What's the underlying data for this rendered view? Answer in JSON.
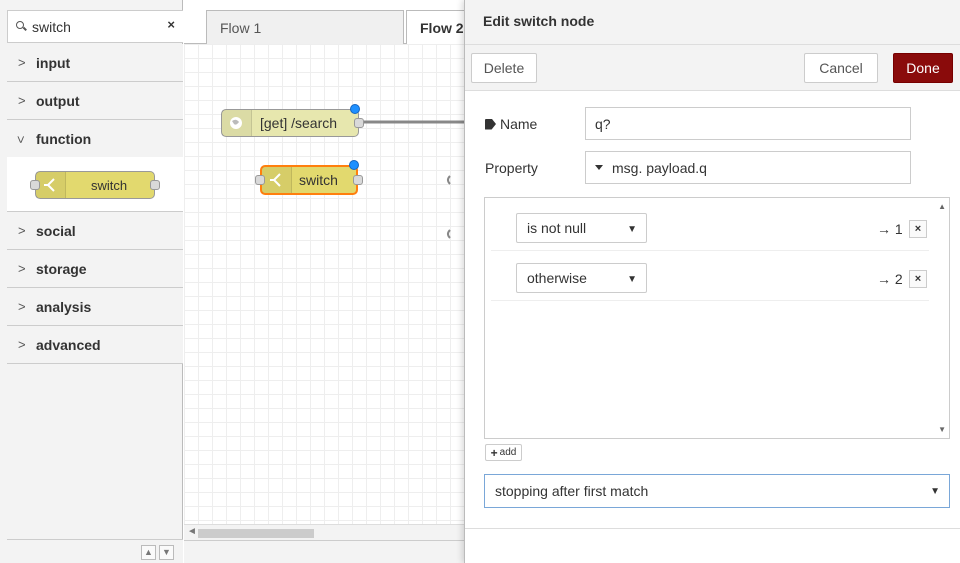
{
  "palette": {
    "search_value": "switch",
    "search_icon": "search-icon",
    "clear_icon": "×",
    "categories": [
      {
        "label": "input",
        "open": false
      },
      {
        "label": "output",
        "open": false
      },
      {
        "label": "function",
        "open": true
      },
      {
        "label": "social",
        "open": false
      },
      {
        "label": "storage",
        "open": false
      },
      {
        "label": "analysis",
        "open": false
      },
      {
        "label": "advanced",
        "open": false
      }
    ],
    "function_node_label": "switch",
    "footer_up": "▲",
    "footer_down": "▼"
  },
  "workspace": {
    "tabs": [
      {
        "label": "Flow 1",
        "active": false
      },
      {
        "label": "Flow 2",
        "active": true
      }
    ],
    "nodes": {
      "http_in_label": "[get] /search",
      "switch_label": "switch"
    },
    "scroll_arrow": "◄"
  },
  "editor": {
    "title": "Edit switch node",
    "delete_label": "Delete",
    "cancel_label": "Cancel",
    "done_label": "Done",
    "name_label": "Name",
    "name_value": "q?",
    "property_label": "Property",
    "property_value": "msg. payload.q",
    "rules": [
      {
        "operator": "is not null",
        "output": "→ 1"
      },
      {
        "operator": "otherwise",
        "output": "→ 2"
      }
    ],
    "delete_rule_icon": "×",
    "add_label": "add",
    "add_plus": "+",
    "mode_value": "stopping after first match",
    "dropdown_caret": "▼"
  },
  "colors": {
    "function_node": "#e2d96e",
    "http_node": "#e7e7ae",
    "done_button": "#8a0b0b",
    "selected_border": "#ff7f0e",
    "port_dot": "#1e90ff"
  }
}
